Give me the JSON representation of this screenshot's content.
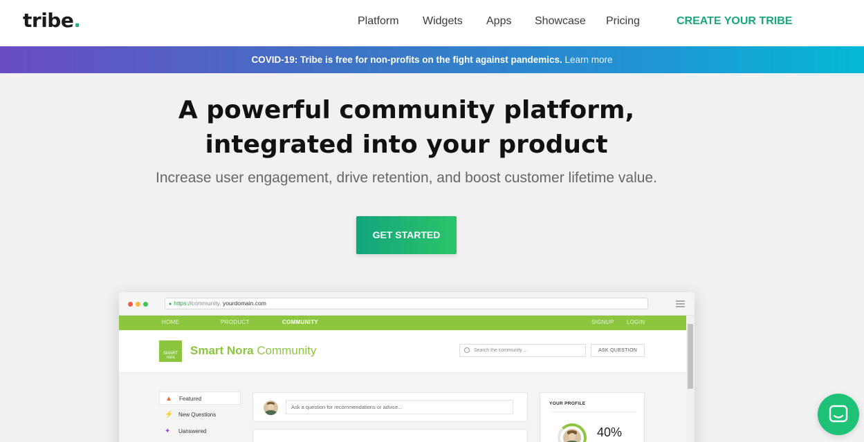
{
  "header": {
    "logo": "tribe",
    "logo_dot": ".",
    "nav": [
      "Platform",
      "Widgets",
      "Apps",
      "Showcase",
      "Pricing"
    ],
    "cta": "CREATE YOUR TRIBE"
  },
  "banner": {
    "bold": "COVID-19: Tribe is free for non-profits on the fight against pandemics.",
    "link": "Learn more"
  },
  "hero": {
    "title_line1": "A powerful community platform,",
    "title_line2": "integrated into your product",
    "subtitle": "Increase user engagement, drive retention, and boost customer lifetime value.",
    "button": "GET STARTED"
  },
  "mockup": {
    "url_protocol": "https://",
    "url_sub": "community.",
    "url_domain": "yourdomain.com",
    "nav_left": [
      "HOME",
      "PRODUCT",
      "COMMUNITY"
    ],
    "nav_right": [
      "SIGNUP",
      "LOGIN"
    ],
    "logo_text_top": "SMART",
    "logo_text_bottom": "nora",
    "community_brand": "Smart Nora",
    "community_word": "Community",
    "search_placeholder": "Search the community ...",
    "ask_button": "ASK QUESTION",
    "sidebar": [
      "Featured",
      "New Questions",
      "Uanswered"
    ],
    "ask_placeholder": "Ask a question for recommendations or advice...",
    "profile_title": "YOUR PROFILE",
    "profile_percent": "40%"
  },
  "colors": {
    "brand_green": "#1aa57b",
    "community_green": "#8cc63f",
    "chat_green": "#1ec276"
  },
  "icons": [
    "fire-icon",
    "lightning-icon",
    "unanswered-icon",
    "lock-icon",
    "search-icon",
    "menu-icon",
    "chat-icon"
  ]
}
